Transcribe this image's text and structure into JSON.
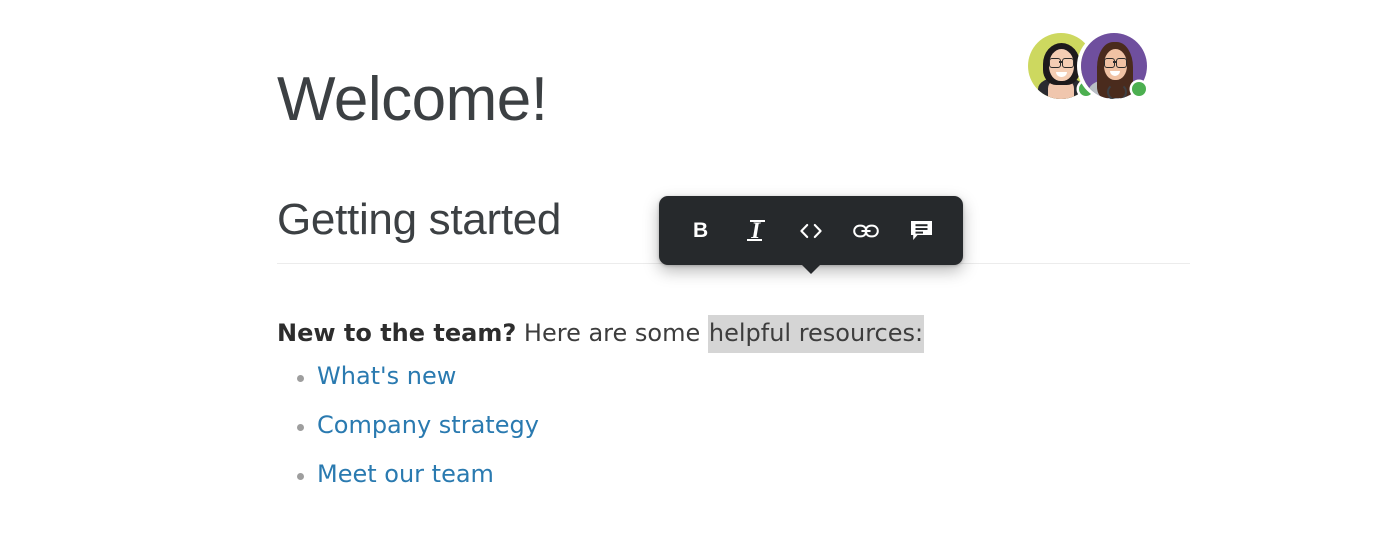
{
  "page": {
    "background_color": "#ffffff",
    "title": "Welcome!",
    "subtitle": "Getting started"
  },
  "paragraph": {
    "lead": "New to the team?",
    "middle": " Here are some ",
    "selected": "helpful resources:",
    "selection_highlight_color": "#d5d5d5"
  },
  "links": [
    {
      "label": "What's new"
    },
    {
      "label": "Company strategy"
    },
    {
      "label": "Meet our team"
    }
  ],
  "link_color": "#2a7ab0",
  "toolbar": {
    "background_color": "#26292c",
    "buttons": [
      {
        "name": "bold-button",
        "icon": "bold-icon",
        "label": "B",
        "title": "Bold"
      },
      {
        "name": "italic-button",
        "icon": "italic-icon",
        "label": "I",
        "title": "Italic"
      },
      {
        "name": "code-button",
        "icon": "code-icon",
        "label": "<>",
        "title": "Code"
      },
      {
        "name": "link-button",
        "icon": "link-icon",
        "label": "",
        "title": "Link"
      },
      {
        "name": "comment-button",
        "icon": "comment-icon",
        "label": "",
        "title": "Comment"
      }
    ]
  },
  "avatars": [
    {
      "name": "avatar-1",
      "background_color": "#cdd85f",
      "status": "online",
      "status_color": "#4caf50"
    },
    {
      "name": "avatar-2",
      "background_color": "#6f4f9e",
      "status": "online",
      "status_color": "#4caf50"
    }
  ]
}
